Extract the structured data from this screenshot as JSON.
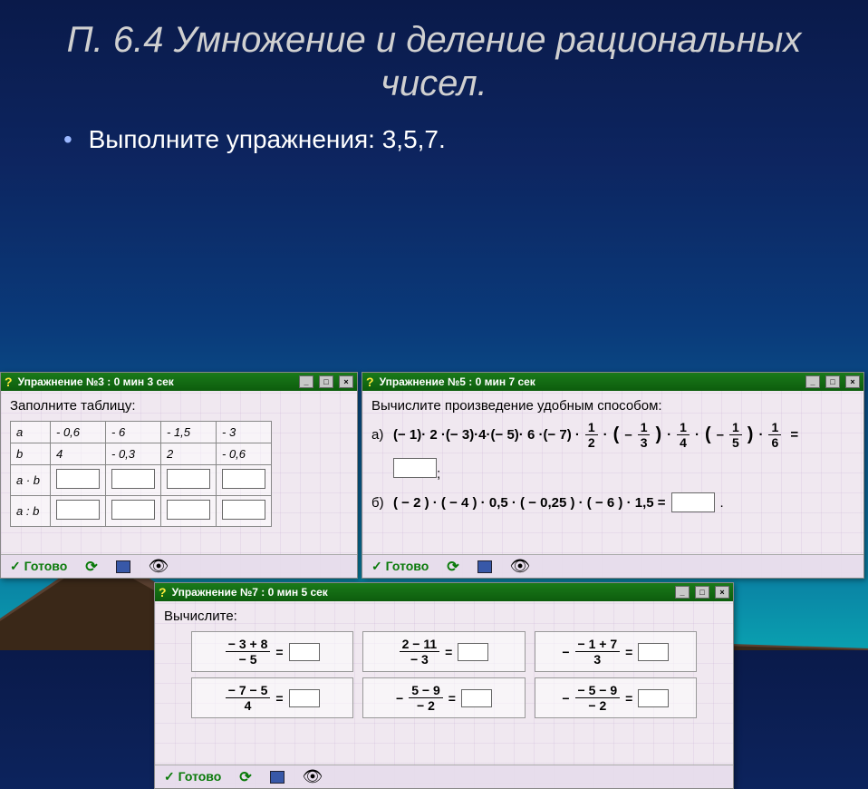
{
  "slide": {
    "title": "П. 6.4 Умножение и деление рациональных чисел.",
    "bullet": "Выполните упражнения: 3,5,7."
  },
  "win3": {
    "title": "Упражнение №3 : 0 мин  3 сек",
    "instruction": "Заполните таблицу:",
    "rows": {
      "header": [
        "a",
        "b",
        "a · b",
        "a : b"
      ],
      "a": [
        "- 0,6",
        "- 6",
        "- 1,5",
        "- 3"
      ],
      "b": [
        "4",
        "- 0,3",
        "2",
        "- 0,6"
      ]
    }
  },
  "win5": {
    "title": "Упражнение №5 : 0 мин  7 сек",
    "instruction": "Вычислите произведение удобным способом:",
    "item_a_label": "а)",
    "item_a_expr_plain": "(− 1)· 2 ·(− 3)·4·(− 5)· 6 ·(− 7) ·",
    "item_a_fracs": [
      {
        "n": "1",
        "d": "2"
      },
      {
        "neg": "–",
        "n": "1",
        "d": "3"
      },
      {
        "n": "1",
        "d": "4"
      },
      {
        "neg": "–",
        "n": "1",
        "d": "5"
      },
      {
        "n": "1",
        "d": "6"
      }
    ],
    "item_b_label": "б)",
    "item_b_expr": "( − 2 ) · ( − 4 ) · 0,5 · ( − 0,25 ) · ( − 6 ) · 1,5 ="
  },
  "win7": {
    "title": "Упражнение №7 : 0 мин  5 сек",
    "instruction": "Вычислите:",
    "cells": [
      {
        "neg": "",
        "n": "− 3 + 8",
        "d": "− 5"
      },
      {
        "neg": "",
        "n": "2 − 11",
        "d": "− 3"
      },
      {
        "neg": "−",
        "n": "− 1 + 7",
        "d": "3"
      },
      {
        "neg": "",
        "n": "− 7 − 5",
        "d": "4"
      },
      {
        "neg": "−",
        "n": "5 − 9",
        "d": "− 2"
      },
      {
        "neg": "−",
        "n": "− 5 − 9",
        "d": "− 2"
      }
    ]
  },
  "toolbar": {
    "ready": "Готово"
  }
}
